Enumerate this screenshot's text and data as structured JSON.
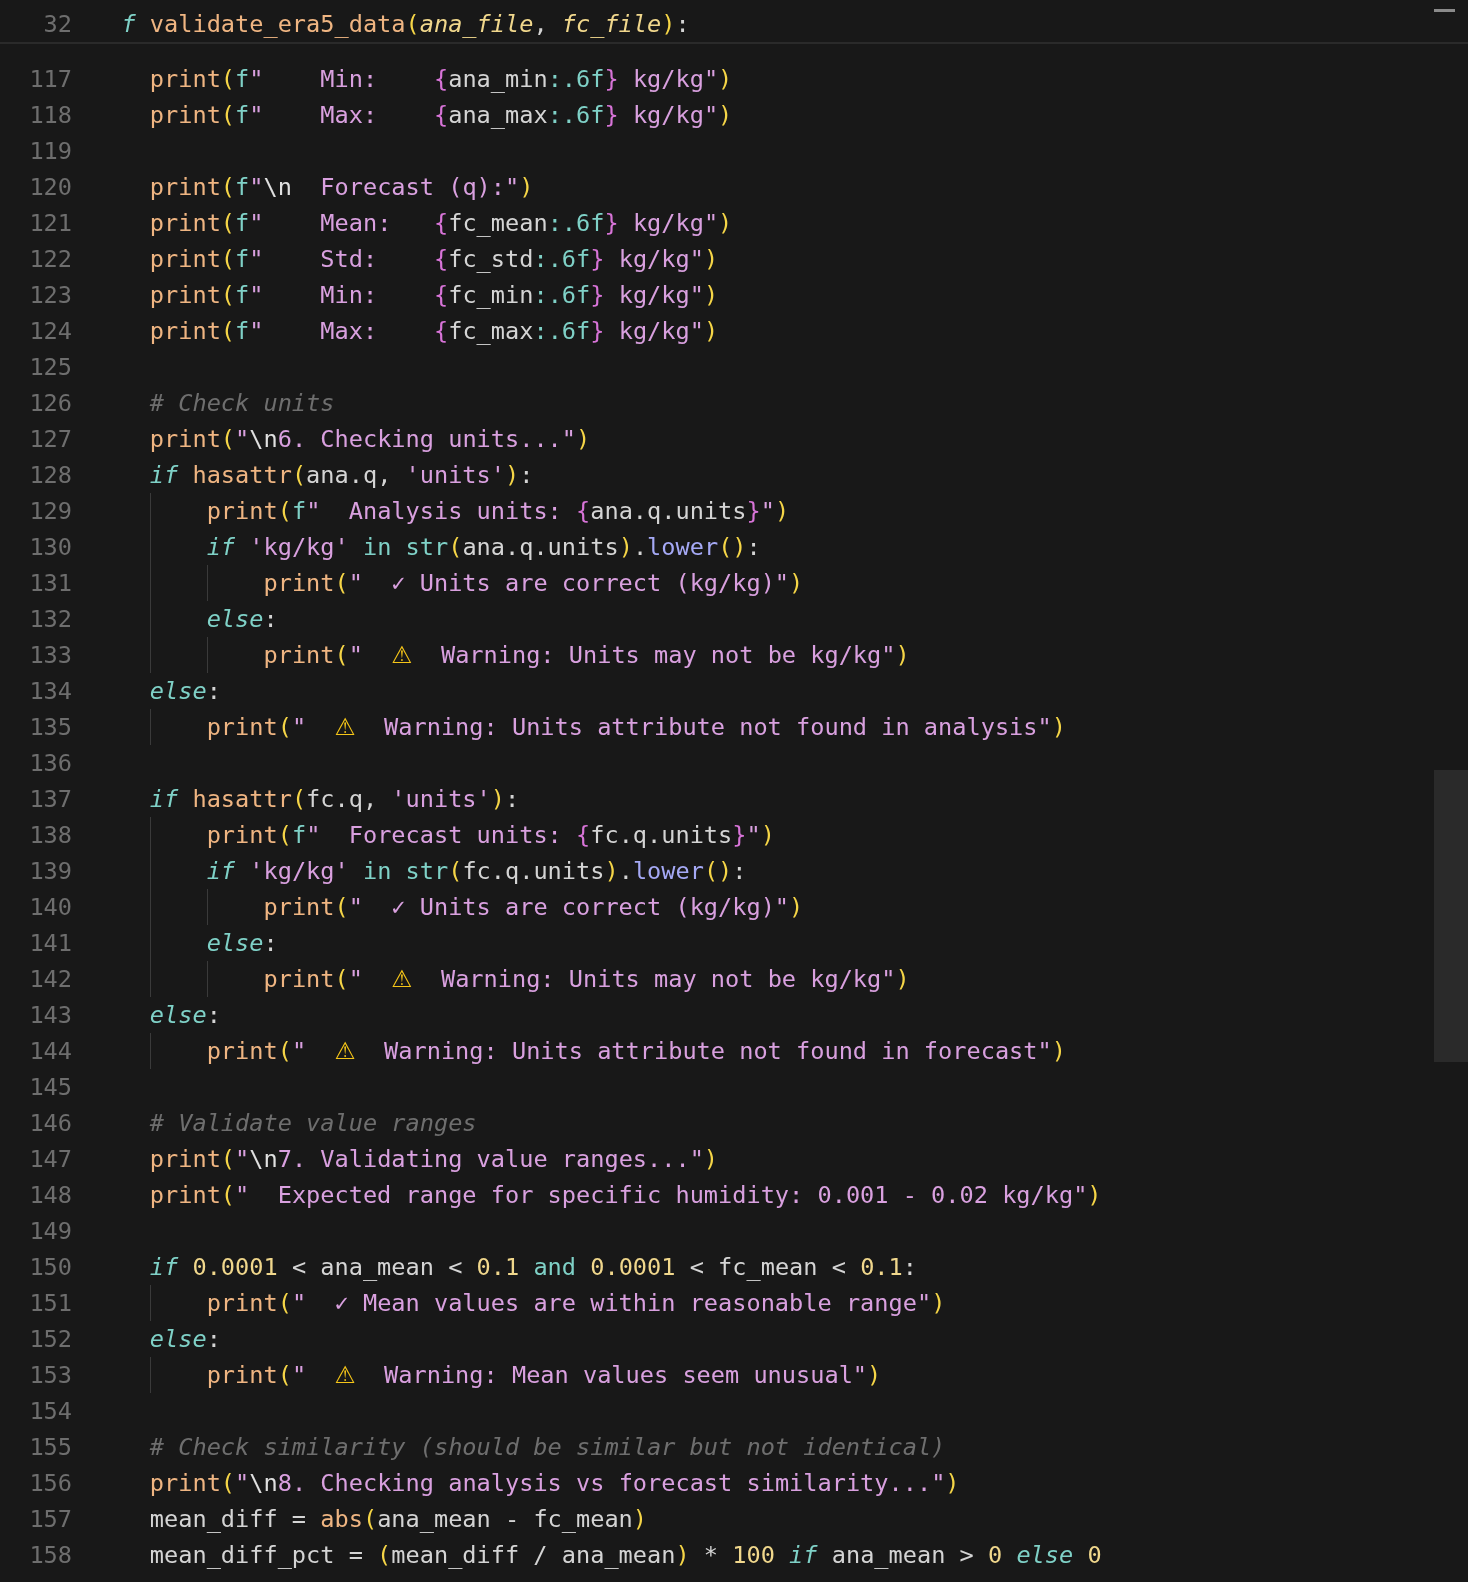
{
  "sticky_header": {
    "number": "32",
    "tokens": [
      {
        "kind": "kw",
        "text": "f "
      },
      {
        "kind": "fn",
        "text": "validate_era5_data"
      },
      {
        "kind": "paren",
        "text": "("
      },
      {
        "kind": "param",
        "text": "ana_file"
      },
      {
        "kind": "plain",
        "text": ", "
      },
      {
        "kind": "param",
        "text": "fc_file"
      },
      {
        "kind": "paren",
        "text": ")"
      },
      {
        "kind": "plain",
        "text": ":"
      }
    ]
  },
  "lines": [
    {
      "number": "117",
      "tokens": [
        {
          "kind": "fn",
          "text": "print"
        },
        {
          "kind": "paren",
          "text": "("
        },
        {
          "kind": "fpre",
          "text": "f"
        },
        {
          "kind": "str",
          "text": "\"    Min:    "
        },
        {
          "kind": "brace",
          "text": "{"
        },
        {
          "kind": "plain",
          "text": "ana_min"
        },
        {
          "kind": "spec",
          "text": ":.6f"
        },
        {
          "kind": "brace",
          "text": "}"
        },
        {
          "kind": "str",
          "text": " kg/kg\""
        },
        {
          "kind": "paren",
          "text": ")"
        }
      ]
    },
    {
      "number": "118",
      "tokens": [
        {
          "kind": "fn",
          "text": "print"
        },
        {
          "kind": "paren",
          "text": "("
        },
        {
          "kind": "fpre",
          "text": "f"
        },
        {
          "kind": "str",
          "text": "\"    Max:    "
        },
        {
          "kind": "brace",
          "text": "{"
        },
        {
          "kind": "plain",
          "text": "ana_max"
        },
        {
          "kind": "spec",
          "text": ":.6f"
        },
        {
          "kind": "brace",
          "text": "}"
        },
        {
          "kind": "str",
          "text": " kg/kg\""
        },
        {
          "kind": "paren",
          "text": ")"
        }
      ]
    },
    {
      "number": "119"
    },
    {
      "number": "120",
      "tokens": [
        {
          "kind": "fn",
          "text": "print"
        },
        {
          "kind": "paren",
          "text": "("
        },
        {
          "kind": "fpre",
          "text": "f"
        },
        {
          "kind": "str",
          "text": "\""
        },
        {
          "kind": "esc",
          "text": "\\n"
        },
        {
          "kind": "str",
          "text": "  Forecast (q):\""
        },
        {
          "kind": "paren",
          "text": ")"
        }
      ]
    },
    {
      "number": "121",
      "tokens": [
        {
          "kind": "fn",
          "text": "print"
        },
        {
          "kind": "paren",
          "text": "("
        },
        {
          "kind": "fpre",
          "text": "f"
        },
        {
          "kind": "str",
          "text": "\"    Mean:   "
        },
        {
          "kind": "brace",
          "text": "{"
        },
        {
          "kind": "plain",
          "text": "fc_mean"
        },
        {
          "kind": "spec",
          "text": ":.6f"
        },
        {
          "kind": "brace",
          "text": "}"
        },
        {
          "kind": "str",
          "text": " kg/kg\""
        },
        {
          "kind": "paren",
          "text": ")"
        }
      ]
    },
    {
      "number": "122",
      "tokens": [
        {
          "kind": "fn",
          "text": "print"
        },
        {
          "kind": "paren",
          "text": "("
        },
        {
          "kind": "fpre",
          "text": "f"
        },
        {
          "kind": "str",
          "text": "\"    Std:    "
        },
        {
          "kind": "brace",
          "text": "{"
        },
        {
          "kind": "plain",
          "text": "fc_std"
        },
        {
          "kind": "spec",
          "text": ":.6f"
        },
        {
          "kind": "brace",
          "text": "}"
        },
        {
          "kind": "str",
          "text": " kg/kg\""
        },
        {
          "kind": "paren",
          "text": ")"
        }
      ]
    },
    {
      "number": "123",
      "tokens": [
        {
          "kind": "fn",
          "text": "print"
        },
        {
          "kind": "paren",
          "text": "("
        },
        {
          "kind": "fpre",
          "text": "f"
        },
        {
          "kind": "str",
          "text": "\"    Min:    "
        },
        {
          "kind": "brace",
          "text": "{"
        },
        {
          "kind": "plain",
          "text": "fc_min"
        },
        {
          "kind": "spec",
          "text": ":.6f"
        },
        {
          "kind": "brace",
          "text": "}"
        },
        {
          "kind": "str",
          "text": " kg/kg\""
        },
        {
          "kind": "paren",
          "text": ")"
        }
      ]
    },
    {
      "number": "124",
      "tokens": [
        {
          "kind": "fn",
          "text": "print"
        },
        {
          "kind": "paren",
          "text": "("
        },
        {
          "kind": "fpre",
          "text": "f"
        },
        {
          "kind": "str",
          "text": "\"    Max:    "
        },
        {
          "kind": "brace",
          "text": "{"
        },
        {
          "kind": "plain",
          "text": "fc_max"
        },
        {
          "kind": "spec",
          "text": ":.6f"
        },
        {
          "kind": "brace",
          "text": "}"
        },
        {
          "kind": "str",
          "text": " kg/kg\""
        },
        {
          "kind": "paren",
          "text": ")"
        }
      ]
    },
    {
      "number": "125"
    },
    {
      "number": "126",
      "tokens": [
        {
          "kind": "comment",
          "text": "# Check units"
        }
      ]
    },
    {
      "number": "127",
      "tokens": [
        {
          "kind": "fn",
          "text": "print"
        },
        {
          "kind": "paren",
          "text": "("
        },
        {
          "kind": "str",
          "text": "\""
        },
        {
          "kind": "esc",
          "text": "\\n"
        },
        {
          "kind": "str",
          "text": "6. Checking units...\""
        },
        {
          "kind": "paren",
          "text": ")"
        }
      ]
    },
    {
      "number": "128",
      "tokens": [
        {
          "kind": "kw",
          "text": "if "
        },
        {
          "kind": "fn",
          "text": "hasattr"
        },
        {
          "kind": "paren",
          "text": "("
        },
        {
          "kind": "plain",
          "text": "ana.q, "
        },
        {
          "kind": "str",
          "text": "'units'"
        },
        {
          "kind": "paren",
          "text": ")"
        },
        {
          "kind": "plain",
          "text": ":"
        }
      ],
      "children": [
        {
          "number": "129",
          "tokens": [
            {
              "kind": "fn",
              "text": "print"
            },
            {
              "kind": "paren",
              "text": "("
            },
            {
              "kind": "fpre",
              "text": "f"
            },
            {
              "kind": "str",
              "text": "\"  Analysis units: "
            },
            {
              "kind": "brace",
              "text": "{"
            },
            {
              "kind": "plain",
              "text": "ana.q.units"
            },
            {
              "kind": "brace",
              "text": "}"
            },
            {
              "kind": "str",
              "text": "\""
            },
            {
              "kind": "paren",
              "text": ")"
            }
          ]
        },
        {
          "number": "130",
          "tokens": [
            {
              "kind": "kw",
              "text": "if "
            },
            {
              "kind": "str",
              "text": "'kg/kg' "
            },
            {
              "kind": "op",
              "text": "in "
            },
            {
              "kind": "builtin",
              "text": "str"
            },
            {
              "kind": "paren",
              "text": "("
            },
            {
              "kind": "plain",
              "text": "ana.q.units"
            },
            {
              "kind": "paren",
              "text": ")"
            },
            {
              "kind": "plain",
              "text": "."
            },
            {
              "kind": "method",
              "text": "lower"
            },
            {
              "kind": "paren",
              "text": "()"
            },
            {
              "kind": "plain",
              "text": ":"
            }
          ],
          "children": [
            {
              "number": "131",
              "tokens": [
                {
                  "kind": "fn",
                  "text": "print"
                },
                {
                  "kind": "paren",
                  "text": "("
                },
                {
                  "kind": "str",
                  "text": "\"  ✓ Units are correct (kg/kg)\""
                },
                {
                  "kind": "paren",
                  "text": ")"
                }
              ]
            }
          ]
        },
        {
          "number": "132",
          "tokens": [
            {
              "kind": "kw",
              "text": "else"
            },
            {
              "kind": "plain",
              "text": ":"
            }
          ],
          "children": [
            {
              "number": "133",
              "tokens": [
                {
                  "kind": "fn",
                  "text": "print"
                },
                {
                  "kind": "paren",
                  "text": "("
                },
                {
                  "kind": "str",
                  "text": "\"  "
                },
                {
                  "kind": "emoji",
                  "text": "⚠"
                },
                {
                  "kind": "str",
                  "text": "  Warning: Units may not be kg/kg\""
                },
                {
                  "kind": "paren",
                  "text": ")"
                }
              ]
            }
          ]
        }
      ]
    },
    {
      "number": "134",
      "tokens": [
        {
          "kind": "kw",
          "text": "else"
        },
        {
          "kind": "plain",
          "text": ":"
        }
      ],
      "children": [
        {
          "number": "135",
          "tokens": [
            {
              "kind": "fn",
              "text": "print"
            },
            {
              "kind": "paren",
              "text": "("
            },
            {
              "kind": "str",
              "text": "\"  "
            },
            {
              "kind": "emoji",
              "text": "⚠"
            },
            {
              "kind": "str",
              "text": "  Warning: Units attribute not found in analysis\""
            },
            {
              "kind": "paren",
              "text": ")"
            }
          ]
        }
      ]
    },
    {
      "number": "136"
    },
    {
      "number": "137",
      "tokens": [
        {
          "kind": "kw",
          "text": "if "
        },
        {
          "kind": "fn",
          "text": "hasattr"
        },
        {
          "kind": "paren",
          "text": "("
        },
        {
          "kind": "plain",
          "text": "fc.q, "
        },
        {
          "kind": "str",
          "text": "'units'"
        },
        {
          "kind": "paren",
          "text": ")"
        },
        {
          "kind": "plain",
          "text": ":"
        }
      ],
      "children": [
        {
          "number": "138",
          "tokens": [
            {
              "kind": "fn",
              "text": "print"
            },
            {
              "kind": "paren",
              "text": "("
            },
            {
              "kind": "fpre",
              "text": "f"
            },
            {
              "kind": "str",
              "text": "\"  Forecast units: "
            },
            {
              "kind": "brace",
              "text": "{"
            },
            {
              "kind": "plain",
              "text": "fc.q.units"
            },
            {
              "kind": "brace",
              "text": "}"
            },
            {
              "kind": "str",
              "text": "\""
            },
            {
              "kind": "paren",
              "text": ")"
            }
          ]
        },
        {
          "number": "139",
          "tokens": [
            {
              "kind": "kw",
              "text": "if "
            },
            {
              "kind": "str",
              "text": "'kg/kg' "
            },
            {
              "kind": "op",
              "text": "in "
            },
            {
              "kind": "builtin",
              "text": "str"
            },
            {
              "kind": "paren",
              "text": "("
            },
            {
              "kind": "plain",
              "text": "fc.q.units"
            },
            {
              "kind": "paren",
              "text": ")"
            },
            {
              "kind": "plain",
              "text": "."
            },
            {
              "kind": "method",
              "text": "lower"
            },
            {
              "kind": "paren",
              "text": "()"
            },
            {
              "kind": "plain",
              "text": ":"
            }
          ],
          "children": [
            {
              "number": "140",
              "tokens": [
                {
                  "kind": "fn",
                  "text": "print"
                },
                {
                  "kind": "paren",
                  "text": "("
                },
                {
                  "kind": "str",
                  "text": "\"  ✓ Units are correct (kg/kg)\""
                },
                {
                  "kind": "paren",
                  "text": ")"
                }
              ]
            }
          ]
        },
        {
          "number": "141",
          "tokens": [
            {
              "kind": "kw",
              "text": "else"
            },
            {
              "kind": "plain",
              "text": ":"
            }
          ],
          "children": [
            {
              "number": "142",
              "tokens": [
                {
                  "kind": "fn",
                  "text": "print"
                },
                {
                  "kind": "paren",
                  "text": "("
                },
                {
                  "kind": "str",
                  "text": "\"  "
                },
                {
                  "kind": "emoji",
                  "text": "⚠"
                },
                {
                  "kind": "str",
                  "text": "  Warning: Units may not be kg/kg\""
                },
                {
                  "kind": "paren",
                  "text": ")"
                }
              ]
            }
          ]
        }
      ]
    },
    {
      "number": "143",
      "tokens": [
        {
          "kind": "kw",
          "text": "else"
        },
        {
          "kind": "plain",
          "text": ":"
        }
      ],
      "children": [
        {
          "number": "144",
          "tokens": [
            {
              "kind": "fn",
              "text": "print"
            },
            {
              "kind": "paren",
              "text": "("
            },
            {
              "kind": "str",
              "text": "\"  "
            },
            {
              "kind": "emoji",
              "text": "⚠"
            },
            {
              "kind": "str",
              "text": "  Warning: Units attribute not found in forecast\""
            },
            {
              "kind": "paren",
              "text": ")"
            }
          ]
        }
      ]
    },
    {
      "number": "145"
    },
    {
      "number": "146",
      "tokens": [
        {
          "kind": "comment",
          "text": "# Validate value ranges"
        }
      ]
    },
    {
      "number": "147",
      "tokens": [
        {
          "kind": "fn",
          "text": "print"
        },
        {
          "kind": "paren",
          "text": "("
        },
        {
          "kind": "str",
          "text": "\""
        },
        {
          "kind": "esc",
          "text": "\\n"
        },
        {
          "kind": "str",
          "text": "7. Validating value ranges...\""
        },
        {
          "kind": "paren",
          "text": ")"
        }
      ]
    },
    {
      "number": "148",
      "tokens": [
        {
          "kind": "fn",
          "text": "print"
        },
        {
          "kind": "paren",
          "text": "("
        },
        {
          "kind": "str",
          "text": "\"  Expected range for specific humidity: 0.001 - 0.02 kg/kg\""
        },
        {
          "kind": "paren",
          "text": ")"
        }
      ]
    },
    {
      "number": "149"
    },
    {
      "number": "150",
      "tokens": [
        {
          "kind": "kw",
          "text": "if "
        },
        {
          "kind": "num",
          "text": "0.0001"
        },
        {
          "kind": "plain",
          "text": " < ana_mean < "
        },
        {
          "kind": "num",
          "text": "0.1"
        },
        {
          "kind": "op",
          "text": " and "
        },
        {
          "kind": "num",
          "text": "0.0001"
        },
        {
          "kind": "plain",
          "text": " < fc_mean < "
        },
        {
          "kind": "num",
          "text": "0.1"
        },
        {
          "kind": "plain",
          "text": ":"
        }
      ],
      "children": [
        {
          "number": "151",
          "tokens": [
            {
              "kind": "fn",
              "text": "print"
            },
            {
              "kind": "paren",
              "text": "("
            },
            {
              "kind": "str",
              "text": "\"  ✓ Mean values are within reasonable range\""
            },
            {
              "kind": "paren",
              "text": ")"
            }
          ]
        }
      ]
    },
    {
      "number": "152",
      "tokens": [
        {
          "kind": "kw",
          "text": "else"
        },
        {
          "kind": "plain",
          "text": ":"
        }
      ],
      "children": [
        {
          "number": "153",
          "tokens": [
            {
              "kind": "fn",
              "text": "print"
            },
            {
              "kind": "paren",
              "text": "("
            },
            {
              "kind": "str",
              "text": "\"  "
            },
            {
              "kind": "emoji",
              "text": "⚠"
            },
            {
              "kind": "str",
              "text": "  Warning: Mean values seem unusual\""
            },
            {
              "kind": "paren",
              "text": ")"
            }
          ]
        }
      ]
    },
    {
      "number": "154"
    },
    {
      "number": "155",
      "tokens": [
        {
          "kind": "comment",
          "text": "# Check similarity (should be similar but not identical)"
        }
      ]
    },
    {
      "number": "156",
      "tokens": [
        {
          "kind": "fn",
          "text": "print"
        },
        {
          "kind": "paren",
          "text": "("
        },
        {
          "kind": "str",
          "text": "\""
        },
        {
          "kind": "esc",
          "text": "\\n"
        },
        {
          "kind": "str",
          "text": "8. Checking analysis vs forecast similarity...\""
        },
        {
          "kind": "paren",
          "text": ")"
        }
      ]
    },
    {
      "number": "157",
      "tokens": [
        {
          "kind": "plain",
          "text": "mean_diff = "
        },
        {
          "kind": "fn",
          "text": "abs"
        },
        {
          "kind": "paren",
          "text": "("
        },
        {
          "kind": "plain",
          "text": "ana_mean - fc_mean"
        },
        {
          "kind": "paren",
          "text": ")"
        }
      ]
    },
    {
      "number": "158",
      "tokens": [
        {
          "kind": "plain",
          "text": "mean_diff_pct = "
        },
        {
          "kind": "paren",
          "text": "("
        },
        {
          "kind": "plain",
          "text": "mean_diff / ana_mean"
        },
        {
          "kind": "paren",
          "text": ")"
        },
        {
          "kind": "plain",
          "text": " * "
        },
        {
          "kind": "num",
          "text": "100"
        },
        {
          "kind": "kw",
          "text": " if"
        },
        {
          "kind": "plain",
          "text": " ana_mean > "
        },
        {
          "kind": "num",
          "text": "0"
        },
        {
          "kind": "kw",
          "text": " else "
        },
        {
          "kind": "num",
          "text": "0"
        }
      ]
    }
  ]
}
